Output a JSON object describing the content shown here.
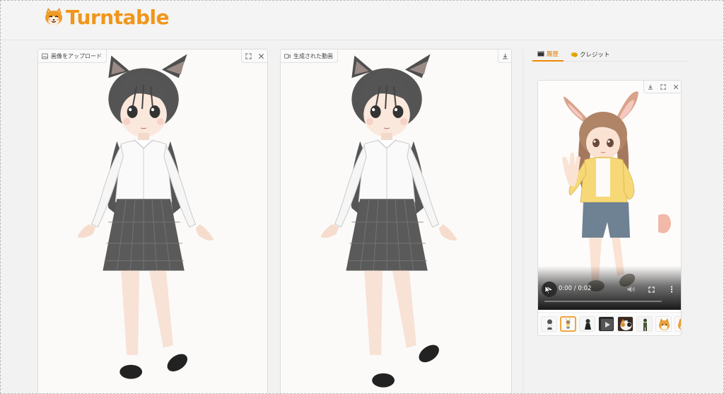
{
  "app": {
    "title": "Turntable"
  },
  "input_panel": {
    "label": "画像をアップロード",
    "label_icon": "image-icon",
    "tools": [
      "fullscreen-icon",
      "close-icon"
    ]
  },
  "output_panel": {
    "label": "生成された動画",
    "label_icon": "video-icon",
    "tools": [
      "download-icon"
    ]
  },
  "tabs": [
    {
      "label": "履歴",
      "icon": "clapper-icon",
      "active": true
    },
    {
      "label": "クレジット",
      "icon": "coin-icon",
      "active": false
    }
  ],
  "history_player": {
    "tools": [
      "download-icon",
      "fullscreen-icon",
      "close-icon"
    ],
    "time": "0:00 / 0:02",
    "progress": 0,
    "controls": [
      "play-icon",
      "volume-icon",
      "fullscreen-icon",
      "more-icon"
    ],
    "thumbnails": [
      {
        "name": "thumb-cat-girl-small"
      },
      {
        "name": "thumb-bunny-girl",
        "selected": true
      },
      {
        "name": "thumb-dark-dress-girl"
      },
      {
        "name": "thumb-video-play"
      },
      {
        "name": "thumb-calico-cat"
      },
      {
        "name": "thumb-soldier"
      },
      {
        "name": "thumb-shiba-dog"
      },
      {
        "name": "thumb-shiba-dog-2"
      }
    ]
  },
  "colors": {
    "accent": "#f08a00",
    "logo": "#f0961a",
    "panel_bg": "#fbfaf8"
  }
}
